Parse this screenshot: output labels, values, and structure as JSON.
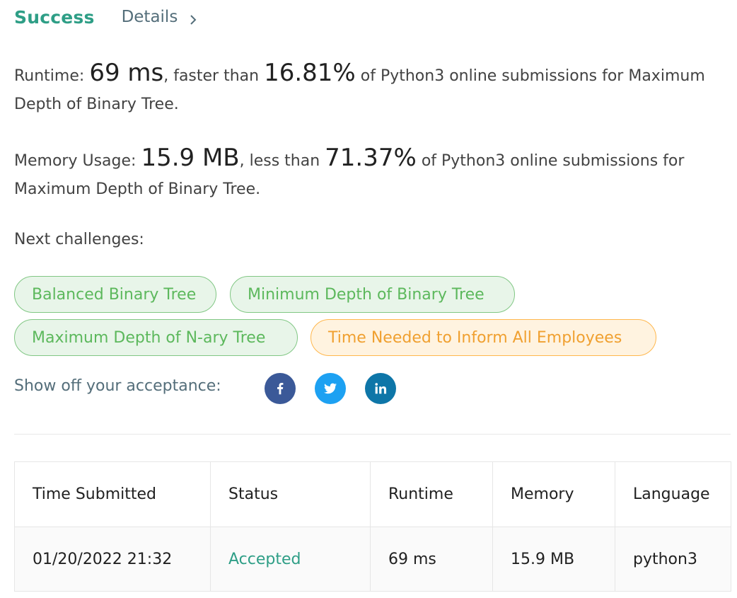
{
  "header": {
    "title": "Success",
    "details_label": "Details"
  },
  "runtime_stat": {
    "label": "Runtime:",
    "value": "69 ms",
    "comparator": ", faster than",
    "percent": "16.81%",
    "suffix": "of Python3 online submissions for Maximum Depth of Binary Tree."
  },
  "memory_stat": {
    "label": "Memory Usage:",
    "value": "15.9 MB",
    "comparator": ", less than",
    "percent": "71.37%",
    "suffix": "of Python3 online submissions for Maximum Depth of Binary Tree."
  },
  "next_challenges": {
    "label": "Next challenges:",
    "items": [
      {
        "label": "Balanced Binary Tree",
        "difficulty": "easy"
      },
      {
        "label": "Minimum Depth of Binary Tree",
        "difficulty": "easy"
      },
      {
        "label": "Maximum Depth of N-ary Tree",
        "difficulty": "easy"
      },
      {
        "label": "Time Needed to Inform All Employees",
        "difficulty": "medium"
      }
    ]
  },
  "share": {
    "label": "Show off your acceptance:",
    "icons": [
      "facebook-icon",
      "twitter-icon",
      "linkedin-icon"
    ]
  },
  "submissions_table": {
    "columns": [
      "Time Submitted",
      "Status",
      "Runtime",
      "Memory",
      "Language"
    ],
    "rows": [
      {
        "time_submitted": "01/20/2022 21:32",
        "status": "Accepted",
        "runtime": "69 ms",
        "memory": "15.9 MB",
        "language": "python3"
      }
    ]
  },
  "colors": {
    "success": "#2e9e86",
    "easy_text": "#5cb85c",
    "easy_bg": "#e8f5e9",
    "medium_text": "#f0a030",
    "medium_bg": "#fff3e0",
    "facebook": "#3b5998",
    "twitter": "#1da1f2",
    "linkedin": "#0e76a8"
  }
}
